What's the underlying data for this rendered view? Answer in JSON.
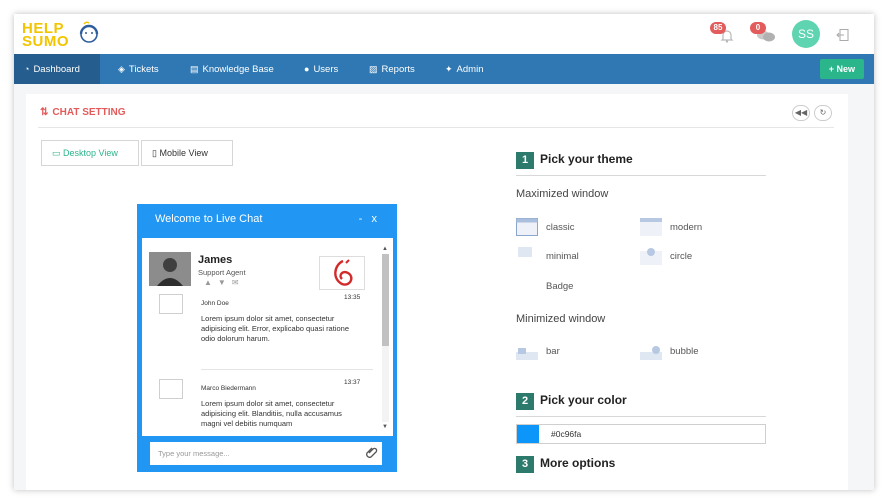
{
  "app": {
    "logo_line1": "HELP",
    "logo_line2": "SUMO",
    "notifications_count": "85",
    "messages_count": "0",
    "user_initials": "SS"
  },
  "nav": {
    "items": [
      {
        "label": "Dashboard",
        "icon": "dashboard-icon"
      },
      {
        "label": "Tickets",
        "icon": "ticket-icon"
      },
      {
        "label": "Knowledge Base",
        "icon": "map-icon"
      },
      {
        "label": "Users",
        "icon": "users-icon"
      },
      {
        "label": "Reports",
        "icon": "chart-icon"
      },
      {
        "label": "Admin",
        "icon": "wrench-icon"
      }
    ],
    "new_label": "+ New"
  },
  "panel": {
    "title": "CHAT SETTING",
    "desktop_view": "Desktop View",
    "mobile_view": "Mobile View"
  },
  "chat": {
    "header": "Welcome to Live Chat",
    "minimize": "-",
    "close": "x",
    "agent_name": "James",
    "agent_role": "Support Agent",
    "messages": [
      {
        "name": "John Doe",
        "time": "13:35",
        "text": "Lorem ipsum dolor sit amet, consectetur adipisicing elit. Error, explicabo quasi ratione odio dolorum harum."
      },
      {
        "name": "Marco Biedermann",
        "time": "13:37",
        "text": "Lorem ipsum dolor sit amet, consectetur adipisicing elit. Blanditiis, nulla accusamus magni vel debitis numquam"
      }
    ],
    "input_placeholder": "Type your message..."
  },
  "theme": {
    "section1_num": "1",
    "section1_title": "Pick your theme",
    "maximized_title": "Maximized window",
    "maximized_options": [
      "classic",
      "modern",
      "minimal",
      "circle"
    ],
    "badge_label": "Badge",
    "minimized_title": "Minimized window",
    "minimized_options": [
      "bar",
      "bubble"
    ],
    "section2_num": "2",
    "section2_title": "Pick your color",
    "color_value": "#0c96fa",
    "section3_num": "3",
    "section3_title": "More options"
  },
  "colors": {
    "accent": "#2196f3",
    "nav": "#2f78b3",
    "success": "#2bb58b",
    "danger": "#e35b5a"
  }
}
